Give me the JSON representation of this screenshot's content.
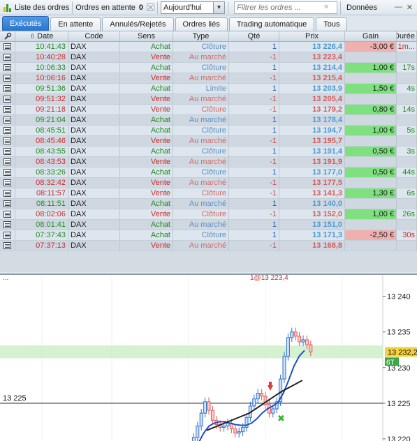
{
  "toolbar": {
    "orders_list_label": "Liste des ordres",
    "pending_label": "Ordres en attente",
    "pending_count": "0",
    "period_value": "Aujourd'hui",
    "filter_placeholder": "Filtrer les ordres ...",
    "data_label": "Données",
    "minimize_glyph": "—",
    "close_glyph": "✕"
  },
  "tabs": [
    {
      "label": "Exécutés",
      "active": true
    },
    {
      "label": "En attente"
    },
    {
      "label": "Annulés/Rejetés"
    },
    {
      "label": "Ordres liés"
    },
    {
      "label": "Trading automatique"
    },
    {
      "label": "Tous"
    }
  ],
  "columns": {
    "date": "Date",
    "code": "Code",
    "sens": "Sens",
    "type": "Type",
    "qte": "Qté",
    "prix": "Prix",
    "gain": "Gain",
    "duree": "Durée"
  },
  "rows": [
    {
      "date": "10:41:43",
      "code": "DAX",
      "sens": "Achat",
      "type": "Clôture",
      "qte": "1",
      "prix": "13 226,4",
      "gain": "-3,00 €",
      "duree": "1m..."
    },
    {
      "date": "10:40:28",
      "code": "DAX",
      "sens": "Vente",
      "type": "Au marché",
      "qte": "-1",
      "prix": "13 223,4",
      "gain": "",
      "duree": ""
    },
    {
      "date": "10:06:33",
      "code": "DAX",
      "sens": "Achat",
      "type": "Clôture",
      "qte": "1",
      "prix": "13 214,4",
      "gain": "1,00 €",
      "duree": "17s"
    },
    {
      "date": "10:06:16",
      "code": "DAX",
      "sens": "Vente",
      "type": "Au marché",
      "qte": "-1",
      "prix": "13 215,4",
      "gain": "",
      "duree": ""
    },
    {
      "date": "09:51:36",
      "code": "DAX",
      "sens": "Achat",
      "type": "Limite",
      "qte": "1",
      "prix": "13 203,9",
      "gain": "1,50 €",
      "duree": "4s"
    },
    {
      "date": "09:51:32",
      "code": "DAX",
      "sens": "Vente",
      "type": "Au marché",
      "qte": "-1",
      "prix": "13 205,4",
      "gain": "",
      "duree": ""
    },
    {
      "date": "09:21:18",
      "code": "DAX",
      "sens": "Vente",
      "type": "Clôture",
      "qte": "-1",
      "prix": "13 179,2",
      "gain": "0,80 €",
      "duree": "14s"
    },
    {
      "date": "09:21:04",
      "code": "DAX",
      "sens": "Achat",
      "type": "Au marché",
      "qte": "1",
      "prix": "13 178,4",
      "gain": "",
      "duree": ""
    },
    {
      "date": "08:45:51",
      "code": "DAX",
      "sens": "Achat",
      "type": "Clôture",
      "qte": "1",
      "prix": "13 194,7",
      "gain": "1,00 €",
      "duree": "5s"
    },
    {
      "date": "08:45:46",
      "code": "DAX",
      "sens": "Vente",
      "type": "Au marché",
      "qte": "-1",
      "prix": "13 195,7",
      "gain": "",
      "duree": ""
    },
    {
      "date": "08:43:55",
      "code": "DAX",
      "sens": "Achat",
      "type": "Clôture",
      "qte": "1",
      "prix": "13 191,4",
      "gain": "0,50 €",
      "duree": "3s"
    },
    {
      "date": "08:43:53",
      "code": "DAX",
      "sens": "Vente",
      "type": "Au marché",
      "qte": "-1",
      "prix": "13 191,9",
      "gain": "",
      "duree": ""
    },
    {
      "date": "08:33:26",
      "code": "DAX",
      "sens": "Achat",
      "type": "Clôture",
      "qte": "1",
      "prix": "13 177,0",
      "gain": "0,50 €",
      "duree": "44s"
    },
    {
      "date": "08:32:42",
      "code": "DAX",
      "sens": "Vente",
      "type": "Au marché",
      "qte": "-1",
      "prix": "13 177,5",
      "gain": "",
      "duree": ""
    },
    {
      "date": "08:11:57",
      "code": "DAX",
      "sens": "Vente",
      "type": "Clôture",
      "qte": "-1",
      "prix": "13 141,3",
      "gain": "1,30 €",
      "duree": "6s"
    },
    {
      "date": "08:11:51",
      "code": "DAX",
      "sens": "Achat",
      "type": "Au marché",
      "qte": "1",
      "prix": "13 140,0",
      "gain": "",
      "duree": ""
    },
    {
      "date": "08:02:06",
      "code": "DAX",
      "sens": "Vente",
      "type": "Clôture",
      "qte": "-1",
      "prix": "13 152,0",
      "gain": "1,00 €",
      "duree": "26s"
    },
    {
      "date": "08:01:41",
      "code": "DAX",
      "sens": "Achat",
      "type": "Au marché",
      "qte": "1",
      "prix": "13 151,0",
      "gain": "",
      "duree": ""
    },
    {
      "date": "07:37:43",
      "code": "DAX",
      "sens": "Achat",
      "type": "Clôture",
      "qte": "1",
      "prix": "13 171,3",
      "gain": "-2,50 €",
      "duree": "30s"
    },
    {
      "date": "07:37:13",
      "code": "DAX",
      "sens": "Vente",
      "type": "Au marché",
      "qte": "-1",
      "prix": "13 168,8",
      "gain": "",
      "duree": ""
    }
  ],
  "chart": {
    "price_labels": [
      "13 240",
      "13 235",
      "13 230",
      "13 225",
      "13 220"
    ],
    "level_label": "13 225",
    "current_price_label": "13 232,2",
    "marker_label": "6T",
    "top_overlay_text": "1@13 223,4",
    "top_left_text": "...",
    "colors": {
      "up": "#2f6fd0",
      "down": "#e05a5a",
      "ma_fast": "#1f4fc8",
      "ma_slow": "#222222",
      "band": "#c8ecc0",
      "price_box": "#f5d23c"
    }
  },
  "chart_data": {
    "type": "line",
    "title": "",
    "xlabel": "",
    "ylabel": "",
    "ylim": [
      13219.5,
      13243
    ],
    "horizontal_lines": [
      13225,
      13232.2
    ],
    "series": [
      {
        "values": [
          13219.0,
          13220.2,
          13221.8,
          13223.6,
          13225.2,
          13224.0,
          13222.6,
          13222.0,
          13221.6,
          13221.8,
          13222.2,
          13221.4,
          13220.8,
          13221.0,
          13221.6,
          13223.0,
          13224.6,
          13225.6,
          13226.4,
          13226.0,
          13224.8,
          13223.6,
          13224.2,
          13225.2,
          13228.4,
          13231.6,
          13234.2,
          13235.0,
          13234.4,
          13233.6,
          13233.9,
          13233.2,
          13232.2
        ]
      },
      {
        "values": [
          13219.4,
          13220.8,
          13221.8,
          13222.2,
          13222.4,
          13222.4,
          13222.2,
          13222.0,
          13221.9,
          13221.9,
          13222.2,
          13222.8,
          13223.6,
          13224.2,
          13224.6,
          13225.1,
          13226.4,
          13228.2,
          13230.2,
          13231.6,
          13232.4
        ]
      },
      {
        "values": [
          13221.2,
          13221.8,
          13222.4,
          13223.0,
          13223.6,
          13224.6,
          13225.6,
          13226.6,
          13227.4,
          13228.2
        ]
      }
    ]
  }
}
